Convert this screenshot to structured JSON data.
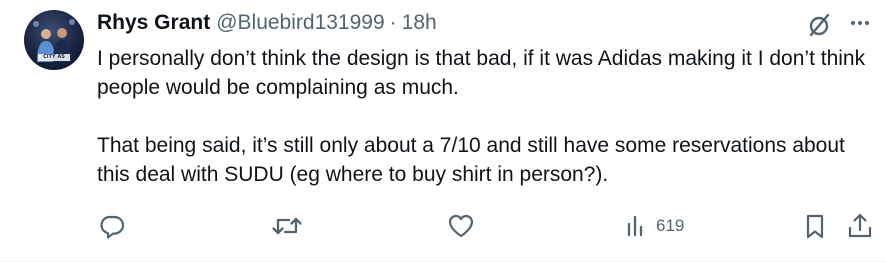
{
  "tweet": {
    "author": {
      "display_name": "Rhys Grant",
      "handle": "@Bluebird131999",
      "avatar_caption": "CITY AS ONE"
    },
    "separator": "·",
    "time": "18h",
    "body": {
      "paragraph_1": "I personally don’t think the design is that bad, if it was Adidas making it I don’t think people would be complaining as much.",
      "paragraph_2": "That being said, it’s still only about a 7/10 and still have some reservations about this deal with SUDU (eg where to buy shirt in person?)."
    },
    "actions": {
      "reply_icon": "speech-bubble-icon",
      "retweet_icon": "retweet-arrows-icon",
      "like_icon": "heart-icon",
      "views_icon": "bar-chart-icon",
      "views_count": "619",
      "bookmark_icon": "bookmark-icon",
      "share_icon": "share-upload-icon"
    },
    "top_icons": {
      "grok": "grok-slash-icon",
      "more": "ellipsis-icon"
    },
    "colors": {
      "text_primary": "#0f1419",
      "text_secondary": "#536471",
      "divider": "#eff3f4"
    }
  }
}
